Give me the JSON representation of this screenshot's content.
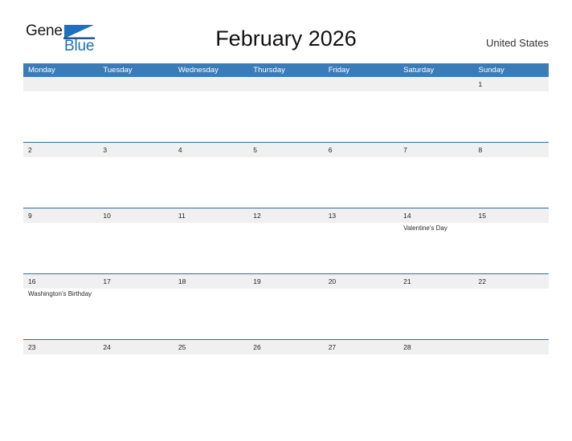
{
  "brand": {
    "name_part1": "General",
    "name_part2": "Blue",
    "logo_icon": "triangle-flag-icon",
    "accent_color": "#1f6fbf"
  },
  "header": {
    "title": "February 2026",
    "country": "United States"
  },
  "calendar": {
    "header_color": "#3b7cb8",
    "band_color": "#f0f0f0",
    "row_rule_color": "#2e6da4",
    "weekday_headers": [
      "Monday",
      "Tuesday",
      "Wednesday",
      "Thursday",
      "Friday",
      "Saturday",
      "Sunday"
    ],
    "weeks": [
      {
        "days": [
          {
            "number": "",
            "events": []
          },
          {
            "number": "",
            "events": []
          },
          {
            "number": "",
            "events": []
          },
          {
            "number": "",
            "events": []
          },
          {
            "number": "",
            "events": []
          },
          {
            "number": "",
            "events": []
          },
          {
            "number": "1",
            "events": []
          }
        ]
      },
      {
        "days": [
          {
            "number": "2",
            "events": []
          },
          {
            "number": "3",
            "events": []
          },
          {
            "number": "4",
            "events": []
          },
          {
            "number": "5",
            "events": []
          },
          {
            "number": "6",
            "events": []
          },
          {
            "number": "7",
            "events": []
          },
          {
            "number": "8",
            "events": []
          }
        ]
      },
      {
        "days": [
          {
            "number": "9",
            "events": []
          },
          {
            "number": "10",
            "events": []
          },
          {
            "number": "11",
            "events": []
          },
          {
            "number": "12",
            "events": []
          },
          {
            "number": "13",
            "events": []
          },
          {
            "number": "14",
            "events": [
              "Valentine's Day"
            ]
          },
          {
            "number": "15",
            "events": []
          }
        ]
      },
      {
        "days": [
          {
            "number": "16",
            "events": [
              "Washington's Birthday"
            ]
          },
          {
            "number": "17",
            "events": []
          },
          {
            "number": "18",
            "events": []
          },
          {
            "number": "19",
            "events": []
          },
          {
            "number": "20",
            "events": []
          },
          {
            "number": "21",
            "events": []
          },
          {
            "number": "22",
            "events": []
          }
        ]
      },
      {
        "days": [
          {
            "number": "23",
            "events": []
          },
          {
            "number": "24",
            "events": []
          },
          {
            "number": "25",
            "events": []
          },
          {
            "number": "26",
            "events": []
          },
          {
            "number": "27",
            "events": []
          },
          {
            "number": "28",
            "events": []
          },
          {
            "number": "",
            "events": []
          }
        ]
      }
    ]
  }
}
